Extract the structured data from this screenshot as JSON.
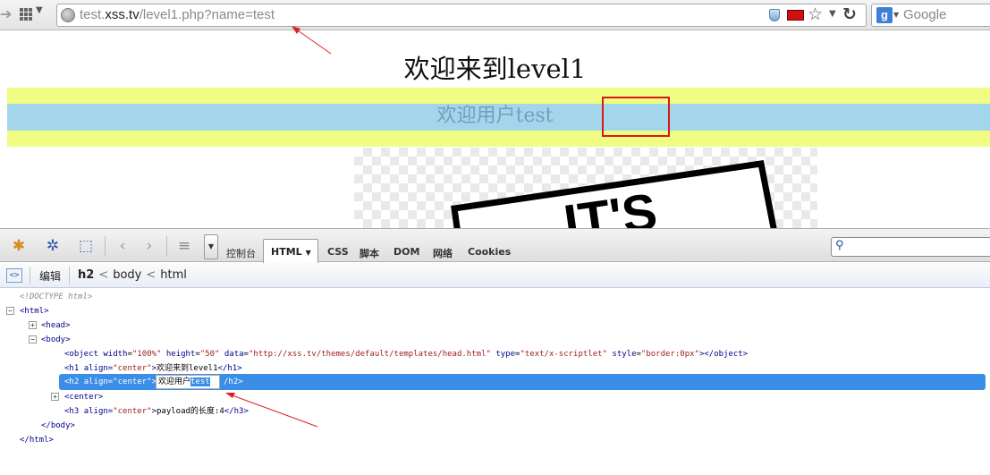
{
  "browser": {
    "url_prefix": "test.",
    "url_domain": "xss.tv",
    "url_rest": "/level1.php?name=test",
    "search_placeholder": "Google",
    "search_engine_letter": "g"
  },
  "page": {
    "heading": "欢迎来到level1",
    "welcome_prefix": "欢迎用户",
    "username": "test",
    "image_text": "IT'S"
  },
  "firebug": {
    "tabs": [
      "控制台",
      "HTML",
      "CSS",
      "脚本",
      "DOM",
      "网络",
      "Cookies"
    ],
    "html_tab_label": "HTML",
    "edit_label": "编辑",
    "breadcrumbs": [
      "h2",
      "body",
      "html"
    ],
    "tree": {
      "doctype": "<!DOCTYPE html>",
      "html_open": "<html>",
      "head": "<head>",
      "body_open": "<body>",
      "object_tag_open": "<object",
      "object_attrs": [
        {
          "name": "width",
          "value": "\"100%\""
        },
        {
          "name": "height",
          "value": "\"50\""
        },
        {
          "name": "data",
          "value": "\"http://xss.tv/themes/default/templates/head.html\""
        },
        {
          "name": "type",
          "value": "\"text/x-scriptlet\""
        },
        {
          "name": "style",
          "value": "\"border:0px\""
        }
      ],
      "object_close": "></object>",
      "h1_open": "<h1",
      "h1_attr": "align=",
      "h1_val": "\"center\"",
      "h1_text": "欢迎来到level1",
      "h1_close": "</h1>",
      "h2_open": "<h2",
      "h2_attr": "align=",
      "h2_val": "\"center\"",
      "h2_text_prefix": "欢迎用户",
      "h2_text_sel": "test",
      "h2_close": "/h2>",
      "center": "<center>",
      "h3_open": "<h3",
      "h3_attr": "align=",
      "h3_val": "\"center\"",
      "h3_text": "payload的长度:4",
      "h3_close": "</h3>",
      "body_close": "</body>",
      "html_close": "</html>"
    }
  },
  "colors": {
    "yellow_band": "#f0fd82",
    "blue_band": "#a3d5eb",
    "highlight_red": "#d81818",
    "selection_blue": "#3b8ee8"
  }
}
